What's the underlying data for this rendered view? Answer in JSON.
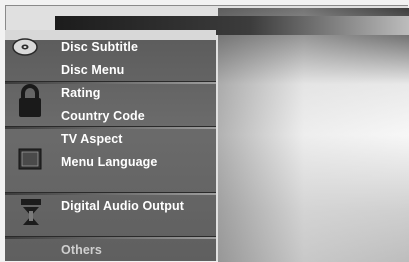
{
  "title": "",
  "categories": [
    {
      "icon": "disc-icon",
      "items": [
        "Disc Subtitle",
        "Disc Menu"
      ]
    },
    {
      "icon": "lock-icon",
      "items": [
        "Rating",
        "Country Code"
      ]
    },
    {
      "icon": "tv-screen-icon",
      "items": [
        "TV Aspect",
        "Menu Language"
      ]
    },
    {
      "icon": "audio-output-icon",
      "items": [
        "Digital Audio Output"
      ]
    },
    {
      "icon": "",
      "items": [
        "Others"
      ]
    }
  ]
}
